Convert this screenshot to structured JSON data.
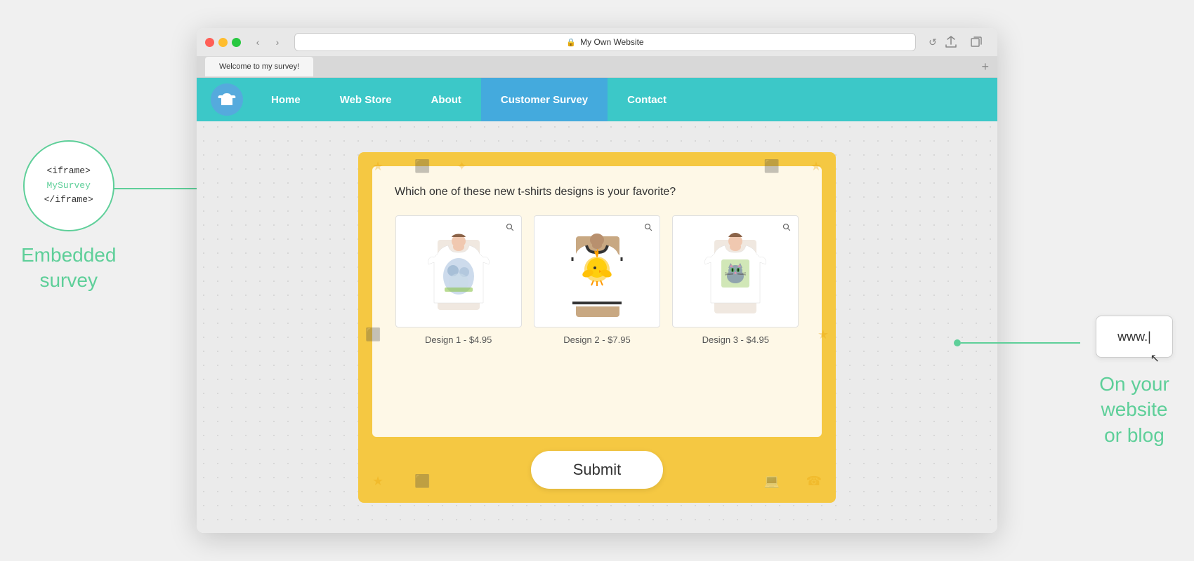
{
  "browser": {
    "url": "My Own Website",
    "tab_label": "Welcome to my survey!",
    "tab_add_label": "+",
    "back_icon": "‹",
    "forward_icon": "›",
    "reload_icon": "↺",
    "share_icon": "⬆",
    "new_tab_icon": "⧉"
  },
  "site": {
    "nav_items": [
      {
        "label": "Home",
        "active": false
      },
      {
        "label": "Web Store",
        "active": false
      },
      {
        "label": "About",
        "active": false
      },
      {
        "label": "Customer Survey",
        "active": true
      },
      {
        "label": "Contact",
        "active": false
      }
    ]
  },
  "survey": {
    "question": "Which one of these new t-shirts designs is your favorite?",
    "designs": [
      {
        "label": "Design 1 - $4.95"
      },
      {
        "label": "Design 2 - $7.95"
      },
      {
        "label": "Design 3 - $4.95"
      }
    ],
    "submit_label": "Submit"
  },
  "annotations": {
    "left_circle_line1": "<iframe>",
    "left_circle_line2": "MySurvey",
    "left_circle_line3": "</iframe>",
    "left_text_line1": "Embedded",
    "left_text_line2": "survey",
    "right_box_text": "www.|",
    "right_text_line1": "On your",
    "right_text_line2": "website",
    "right_text_line3": "or blog"
  }
}
